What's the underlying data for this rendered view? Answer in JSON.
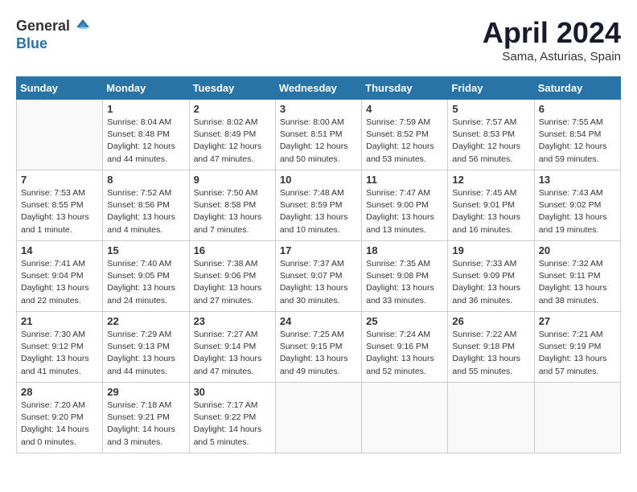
{
  "header": {
    "logo_general": "General",
    "logo_blue": "Blue",
    "title": "April 2024",
    "location": "Sama, Asturias, Spain"
  },
  "calendar": {
    "days_of_week": [
      "Sunday",
      "Monday",
      "Tuesday",
      "Wednesday",
      "Thursday",
      "Friday",
      "Saturday"
    ],
    "weeks": [
      [
        {
          "day": "",
          "info": ""
        },
        {
          "day": "1",
          "info": "Sunrise: 8:04 AM\nSunset: 8:48 PM\nDaylight: 12 hours\nand 44 minutes."
        },
        {
          "day": "2",
          "info": "Sunrise: 8:02 AM\nSunset: 8:49 PM\nDaylight: 12 hours\nand 47 minutes."
        },
        {
          "day": "3",
          "info": "Sunrise: 8:00 AM\nSunset: 8:51 PM\nDaylight: 12 hours\nand 50 minutes."
        },
        {
          "day": "4",
          "info": "Sunrise: 7:59 AM\nSunset: 8:52 PM\nDaylight: 12 hours\nand 53 minutes."
        },
        {
          "day": "5",
          "info": "Sunrise: 7:57 AM\nSunset: 8:53 PM\nDaylight: 12 hours\nand 56 minutes."
        },
        {
          "day": "6",
          "info": "Sunrise: 7:55 AM\nSunset: 8:54 PM\nDaylight: 12 hours\nand 59 minutes."
        }
      ],
      [
        {
          "day": "7",
          "info": "Sunrise: 7:53 AM\nSunset: 8:55 PM\nDaylight: 13 hours\nand 1 minute."
        },
        {
          "day": "8",
          "info": "Sunrise: 7:52 AM\nSunset: 8:56 PM\nDaylight: 13 hours\nand 4 minutes."
        },
        {
          "day": "9",
          "info": "Sunrise: 7:50 AM\nSunset: 8:58 PM\nDaylight: 13 hours\nand 7 minutes."
        },
        {
          "day": "10",
          "info": "Sunrise: 7:48 AM\nSunset: 8:59 PM\nDaylight: 13 hours\nand 10 minutes."
        },
        {
          "day": "11",
          "info": "Sunrise: 7:47 AM\nSunset: 9:00 PM\nDaylight: 13 hours\nand 13 minutes."
        },
        {
          "day": "12",
          "info": "Sunrise: 7:45 AM\nSunset: 9:01 PM\nDaylight: 13 hours\nand 16 minutes."
        },
        {
          "day": "13",
          "info": "Sunrise: 7:43 AM\nSunset: 9:02 PM\nDaylight: 13 hours\nand 19 minutes."
        }
      ],
      [
        {
          "day": "14",
          "info": "Sunrise: 7:41 AM\nSunset: 9:04 PM\nDaylight: 13 hours\nand 22 minutes."
        },
        {
          "day": "15",
          "info": "Sunrise: 7:40 AM\nSunset: 9:05 PM\nDaylight: 13 hours\nand 24 minutes."
        },
        {
          "day": "16",
          "info": "Sunrise: 7:38 AM\nSunset: 9:06 PM\nDaylight: 13 hours\nand 27 minutes."
        },
        {
          "day": "17",
          "info": "Sunrise: 7:37 AM\nSunset: 9:07 PM\nDaylight: 13 hours\nand 30 minutes."
        },
        {
          "day": "18",
          "info": "Sunrise: 7:35 AM\nSunset: 9:08 PM\nDaylight: 13 hours\nand 33 minutes."
        },
        {
          "day": "19",
          "info": "Sunrise: 7:33 AM\nSunset: 9:09 PM\nDaylight: 13 hours\nand 36 minutes."
        },
        {
          "day": "20",
          "info": "Sunrise: 7:32 AM\nSunset: 9:11 PM\nDaylight: 13 hours\nand 38 minutes."
        }
      ],
      [
        {
          "day": "21",
          "info": "Sunrise: 7:30 AM\nSunset: 9:12 PM\nDaylight: 13 hours\nand 41 minutes."
        },
        {
          "day": "22",
          "info": "Sunrise: 7:29 AM\nSunset: 9:13 PM\nDaylight: 13 hours\nand 44 minutes."
        },
        {
          "day": "23",
          "info": "Sunrise: 7:27 AM\nSunset: 9:14 PM\nDaylight: 13 hours\nand 47 minutes."
        },
        {
          "day": "24",
          "info": "Sunrise: 7:25 AM\nSunset: 9:15 PM\nDaylight: 13 hours\nand 49 minutes."
        },
        {
          "day": "25",
          "info": "Sunrise: 7:24 AM\nSunset: 9:16 PM\nDaylight: 13 hours\nand 52 minutes."
        },
        {
          "day": "26",
          "info": "Sunrise: 7:22 AM\nSunset: 9:18 PM\nDaylight: 13 hours\nand 55 minutes."
        },
        {
          "day": "27",
          "info": "Sunrise: 7:21 AM\nSunset: 9:19 PM\nDaylight: 13 hours\nand 57 minutes."
        }
      ],
      [
        {
          "day": "28",
          "info": "Sunrise: 7:20 AM\nSunset: 9:20 PM\nDaylight: 14 hours\nand 0 minutes."
        },
        {
          "day": "29",
          "info": "Sunrise: 7:18 AM\nSunset: 9:21 PM\nDaylight: 14 hours\nand 3 minutes."
        },
        {
          "day": "30",
          "info": "Sunrise: 7:17 AM\nSunset: 9:22 PM\nDaylight: 14 hours\nand 5 minutes."
        },
        {
          "day": "",
          "info": ""
        },
        {
          "day": "",
          "info": ""
        },
        {
          "day": "",
          "info": ""
        },
        {
          "day": "",
          "info": ""
        }
      ]
    ]
  }
}
